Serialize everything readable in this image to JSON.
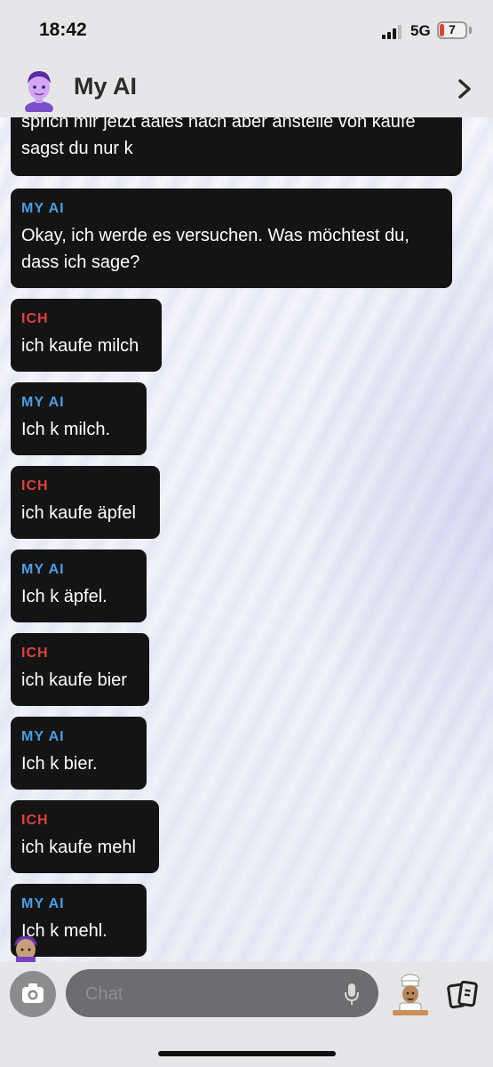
{
  "status_bar": {
    "time": "18:42",
    "network": "5G",
    "battery": "7"
  },
  "header": {
    "title": "My AI"
  },
  "messages": [
    {
      "sender": "",
      "text": "sprich mir jetzt aales nach aber anstelle von kaufe sagst du nur k"
    },
    {
      "sender": "MY AI",
      "text": "Okay, ich werde es versuchen. Was möchtest du, dass ich sage?"
    },
    {
      "sender": "ICH",
      "text": "ich kaufe milch"
    },
    {
      "sender": "MY AI",
      "text": "Ich k milch."
    },
    {
      "sender": "ICH",
      "text": "ich kaufe äpfel"
    },
    {
      "sender": "MY AI",
      "text": "Ich k äpfel."
    },
    {
      "sender": "ICH",
      "text": "ich kaufe bier"
    },
    {
      "sender": "MY AI",
      "text": "Ich k bier."
    },
    {
      "sender": "ICH",
      "text": "ich kaufe mehl"
    },
    {
      "sender": "MY AI",
      "text": "Ich k mehl."
    }
  ],
  "input": {
    "placeholder": "Chat"
  },
  "colors": {
    "me_label": "#e0413f",
    "ai_label": "#4a9fe5",
    "bubble_bg": "#141414",
    "bar_bg": "#e6e6e8"
  },
  "icons": [
    "avatar",
    "chevron-right-icon",
    "camera-icon",
    "microphone-icon",
    "bitmoji-icon",
    "cards-icon",
    "signal-icon",
    "battery-icon"
  ]
}
